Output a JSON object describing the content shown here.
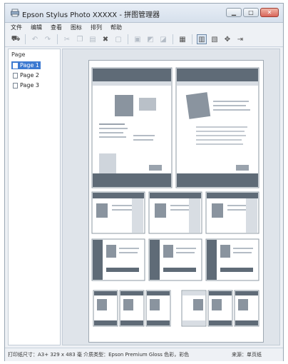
{
  "window": {
    "title": "Epson Stylus Photo XXXXX - 拼图管理器"
  },
  "menubar": [
    "文件",
    "编辑",
    "查看",
    "图标",
    "排列",
    "帮助"
  ],
  "panel": {
    "title": "Page",
    "pages": [
      "Page 1",
      "Page 2",
      "Page 3"
    ],
    "selected_index": 0
  },
  "statusbar": {
    "left": "打印纸尺寸：A3+ 329 x 483 毫  介质类型：Epson Premium Gloss 色彩，彩色",
    "right": "来源：单页纸"
  },
  "colors": {
    "accent": "#3d7ad1",
    "doc_dark": "#5f6b77",
    "doc_light": "#d8dde3",
    "photo": "#8a949f"
  },
  "icons": {
    "app": "printer-icon",
    "toolbar": [
      "select-icon",
      "undo-icon",
      "redo-icon",
      "cut-icon",
      "copy-icon",
      "paste-icon",
      "delete-icon",
      "group-icon",
      "ungroup-icon",
      "front-icon",
      "back-icon",
      "layout-icon",
      "page-view-icon",
      "thumb-view-icon",
      "settings-icon",
      "arrow-icon"
    ]
  }
}
